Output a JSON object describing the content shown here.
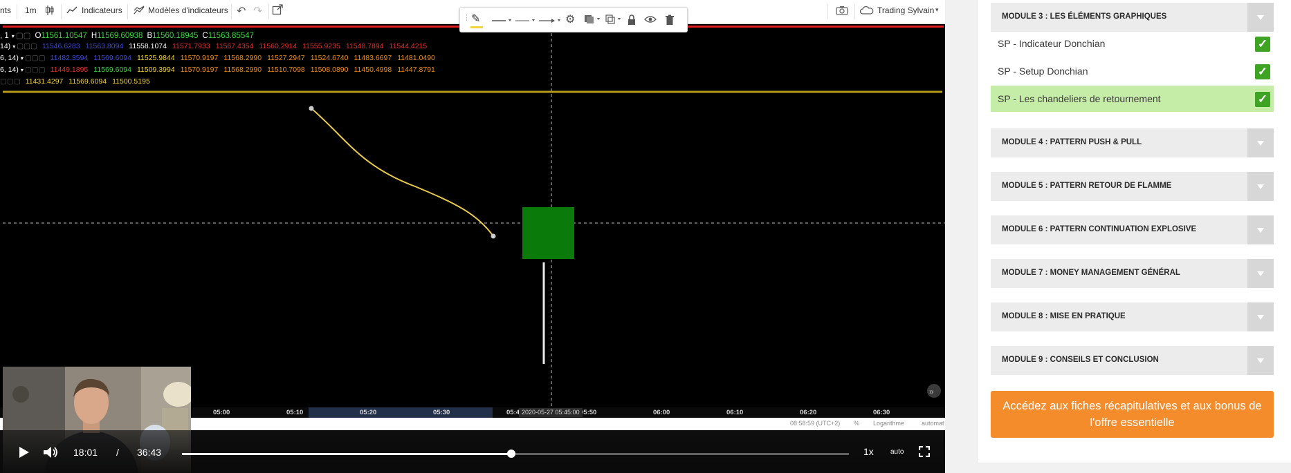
{
  "toolbar": {
    "cut_text": "nts",
    "interval": "1m",
    "indicators": "Indicateurs",
    "templates": "Modèles d'indicateurs",
    "account": "Trading Sylvain"
  },
  "chart": {
    "ohlc_prefix": ", 1",
    "o_label": "O",
    "o_value": "11561.10547",
    "h_label": "H",
    "h_value": "11569.60938",
    "b_label": "B",
    "b_value": "11560.18945",
    "c_label": "C",
    "c_value": "11563.85547",
    "rows": [
      {
        "prefix": "14)",
        "values": [
          "11546.6283",
          "11563.8094",
          "11558.1074",
          "11571.7933",
          "11567.4354",
          "11560.2914",
          "11555.9235",
          "11548.7894",
          "11544.4215"
        ]
      },
      {
        "prefix": "6, 14)",
        "values": [
          "11482.3594",
          "11569.6094",
          "11525.9844",
          "11570.9197",
          "11568.2990",
          "11527.2947",
          "11524.6740",
          "11483.6697",
          "11481.0490"
        ]
      },
      {
        "prefix": "6, 14)",
        "values": [
          "11449.1895",
          "11569.6094",
          "11509.3994",
          "11570.9197",
          "11568.2990",
          "11510.7098",
          "11508.0890",
          "11450.4998",
          "11447.8791"
        ]
      },
      {
        "prefix": "",
        "values": [
          "11431.4297",
          "11569.6094",
          "11500.5195"
        ]
      }
    ],
    "time_ticks": [
      "05:00",
      "05:10",
      "05:20",
      "05:30",
      "05:40",
      "05:50",
      "06:00",
      "06:10",
      "06:20",
      "06:30"
    ],
    "crosshair_time": "2020-05-27 05:45:00",
    "status_time": "08:58:59 (UTC+2)",
    "status_percent": "%",
    "status_log": "Logarithme",
    "status_auto": "automat"
  },
  "player": {
    "current_time": "18:01",
    "separator": "/",
    "duration": "36:43",
    "progress": 0.494,
    "speed": "1x",
    "quality": "auto"
  },
  "sidebar": {
    "module3_title": "MODULE 3 : LES ÉLÉMENTS GRAPHIQUES",
    "lessons": [
      {
        "title": "SP - Indicateur Donchian",
        "done": true
      },
      {
        "title": "SP - Setup Donchian",
        "done": true
      },
      {
        "title": "SP - Les chandeliers de retournement",
        "done": true
      }
    ],
    "modules": [
      "MODULE 4 : PATTERN PUSH & PULL",
      "MODULE 5 : PATTERN RETOUR DE FLAMME",
      "MODULE 6 : PATTERN CONTINUATION EXPLOSIVE",
      "MODULE 7 : MONEY MANAGEMENT GÉNÉRAL",
      "MODULE 8 : MISE EN PRATIQUE",
      "MODULE 9 : CONSEILS ET CONCLUSION"
    ],
    "cta": "Accédez aux fiches récapitulatives et aux bonus de l'offre essentielle"
  },
  "colors": {
    "ohlc_green": "#39d63c",
    "legend_blue": "#3c4ad8",
    "legend_red": "#e0302d",
    "legend_orange": "#f08c1e",
    "legend_yellow": "#f5d33a",
    "candle": "#0a7a0a",
    "curve": "#e6c84a",
    "hline": "#b89a1c",
    "module_bg": "#ececec",
    "lesson_active": "#c6eda8",
    "check": "#3fa324",
    "cta": "#f48c2b"
  }
}
